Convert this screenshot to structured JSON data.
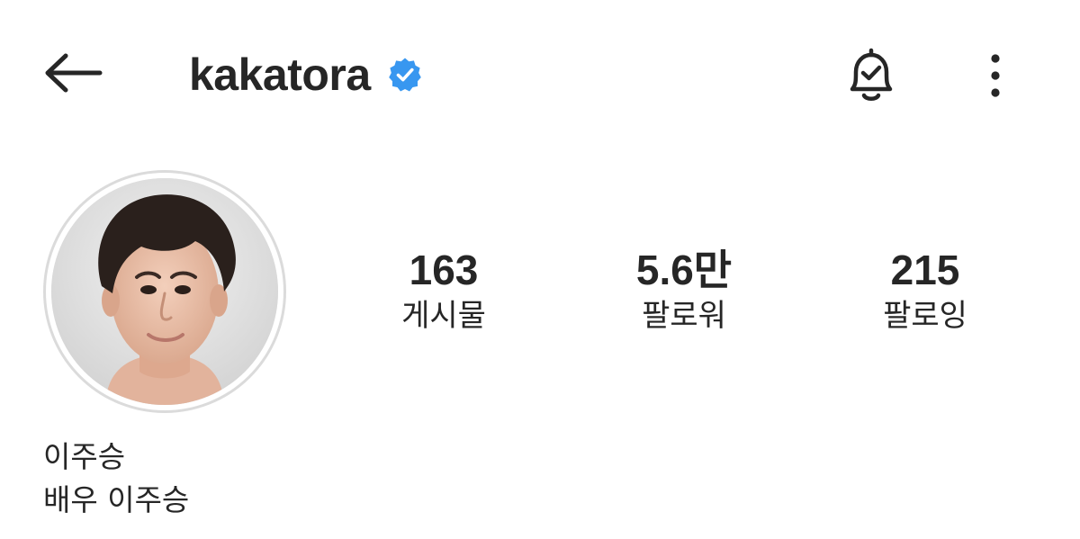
{
  "header": {
    "username": "kakatora",
    "verified": true,
    "back_icon": "arrow-left-icon",
    "bell_icon": "bell-check-icon",
    "more_icon": "more-vertical-icon"
  },
  "profile": {
    "avatar_alt": "profile photo",
    "stats": {
      "posts": {
        "count": "163",
        "label": "게시물"
      },
      "followers": {
        "count": "5.6만",
        "label": "팔로워"
      },
      "following": {
        "count": "215",
        "label": "팔로잉"
      }
    },
    "name": "이주승",
    "bio": "배우 이주승"
  },
  "colors": {
    "text": "#262626",
    "verified_blue": "#3897f0",
    "avatar_ring": "#dbdbdb"
  }
}
